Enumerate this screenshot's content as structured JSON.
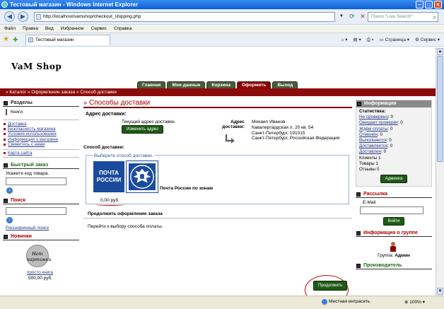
{
  "window": {
    "title": "Тестовый магазин - Windows Internet Explorer"
  },
  "address_bar": {
    "url": "http://localhost/vamshop/checkout_shipping.php",
    "search_placeholder": "Поиск \"Live Search\""
  },
  "menu": [
    "Файл",
    "Правка",
    "Вид",
    "Избранное",
    "Сервис",
    "Справка"
  ],
  "browser_tab": {
    "label": "Тестовый магазин"
  },
  "command_bar": {
    "page": "Страница",
    "tools": "Сервис"
  },
  "site": {
    "logo": "VaM Shop",
    "nav": [
      "Главная",
      "Мои данные",
      "Корзина",
      "Оформить",
      "Выход"
    ],
    "nav_active": "Оформить",
    "breadcrumb": "»  Каталог » Оформление заказа » Способ доставки"
  },
  "left": {
    "sections_title": "Разделы",
    "category": "Книги",
    "info_links": [
      "Доставка",
      "Безопасность магазина",
      "Условия использования",
      "Информация о магазине",
      "Свяжитесь с нами"
    ],
    "sitemap": "Карта сайта",
    "quick_order_title": "Быстрый заказ",
    "quick_order_hint": "Укажите код товара.",
    "search_title": "Поиск",
    "advanced_search": "Расширенный поиск",
    "new_title": "Новинки",
    "no_image": "Нет картинки",
    "product_name": "просто книга",
    "product_price": "500,00 руб."
  },
  "center": {
    "title": "Способы доставки",
    "delivery_address_label": "Адрес доставки:",
    "current_address_text": "Текущий адрес доставки.",
    "change_address_button": "Изменить адрес",
    "address_label": "Адрес доставки:",
    "address_lines": [
      "Михаил Иванов",
      "Кавалергардская л. 20 кв. 54",
      "Санкт-Петербург, 191015",
      "Санкт-Петербург, Российская Федерация"
    ],
    "delivery_label": "Способ доставки:",
    "choose_method": "Выберите способ доставки.",
    "pochta_logo": "ПОЧТА РОССИИ",
    "method_name": "Почта России по зонам",
    "method_price": "0,00 руб.",
    "continue_title": "Продолжить оформление заказа",
    "continue_text": "Перейти к выбору способа оплаты.",
    "continue_button": "Продолжить"
  },
  "right": {
    "info_title": "Информация",
    "stats_title": "Статистика:",
    "stats": [
      {
        "label": "Не проверено",
        "value": "0"
      },
      {
        "label": "Ожидает проверки",
        "value": "0"
      },
      {
        "label": "Ждём оплаты",
        "value": "0"
      },
      {
        "label": "Отменён",
        "value": "0"
      },
      {
        "label": "Выполняется",
        "value": "0"
      },
      {
        "label": "Доставляется",
        "value": "0"
      },
      {
        "label": "Доставлен",
        "value": "0"
      }
    ],
    "clients": "Клиенты 1",
    "goods": "Товары 1",
    "reviews": "Отзывы 0",
    "admin_button": "Админка",
    "mailing_title": "Рассылка",
    "email_label": "E-Mail",
    "login_button": "Войти",
    "group_title": "Информация о группе",
    "group_label": "Группа:",
    "group_value": "Админ",
    "manufacturer_title": "Производитель"
  },
  "status_bar": {
    "zone": "Местная интрасеть",
    "zoom": "100%"
  }
}
